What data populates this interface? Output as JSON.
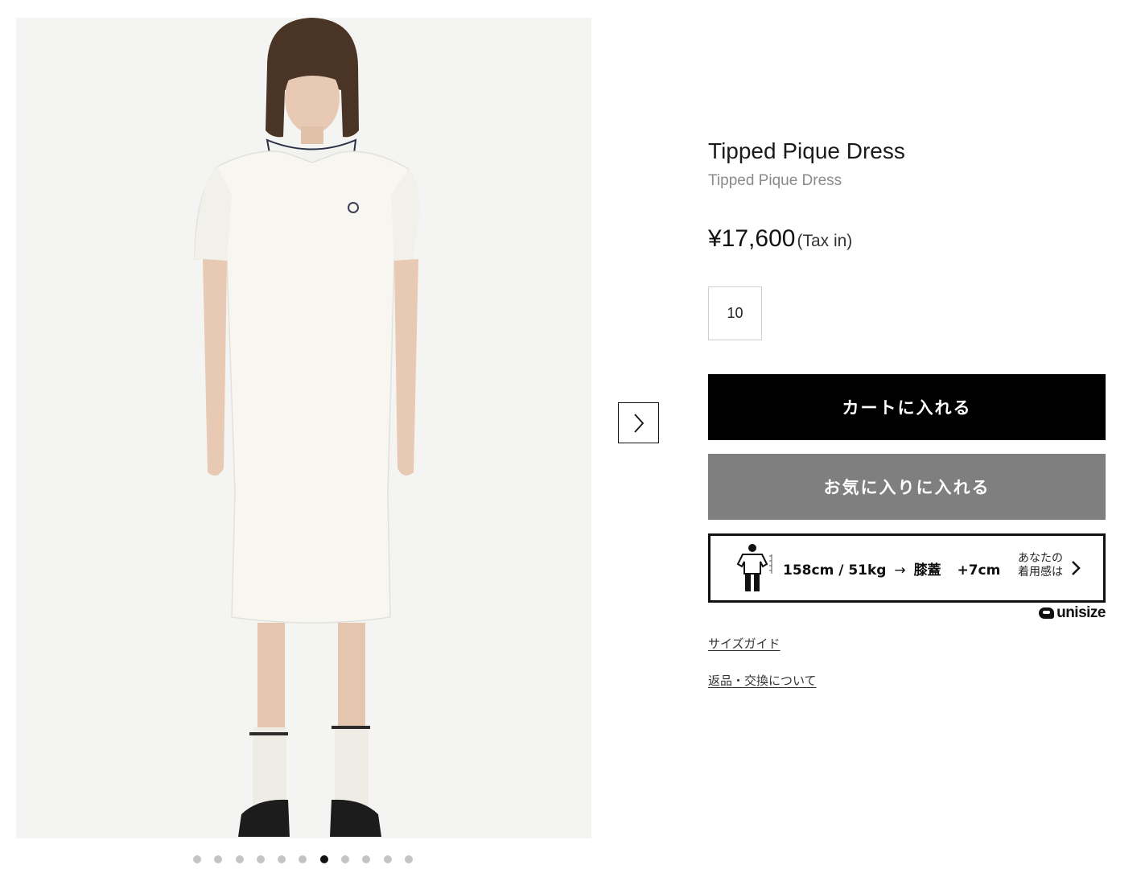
{
  "product": {
    "title": "Tipped Pique Dress",
    "subtitle": "Tipped Pique Dress",
    "price": "¥17,600",
    "tax_label": "(Tax in)",
    "selected_size": "10"
  },
  "actions": {
    "add_to_cart": "カートに入れる",
    "add_to_favorites": "お気に入りに入れる"
  },
  "fit": {
    "measurement": "158cm / 51kg",
    "arrow": "→",
    "point": "膝蓋",
    "offset": "+7cm",
    "side_line1": "あなたの",
    "side_line2": "着用感は",
    "brand": "unisize",
    "figure_icon": "person-measure-icon",
    "chevron_icon": "chevron-right-icon"
  },
  "links": {
    "size_guide": "サイズガイド",
    "returns": "返品・交換について"
  },
  "gallery": {
    "dot_count": 11,
    "active_dot": 7,
    "next_icon": "chevron-right-icon"
  },
  "colors": {
    "cart_button": "#000000",
    "favorite_button": "#7f7f7f",
    "active_dot": "#111111",
    "inactive_dot": "#c4c4c4"
  }
}
